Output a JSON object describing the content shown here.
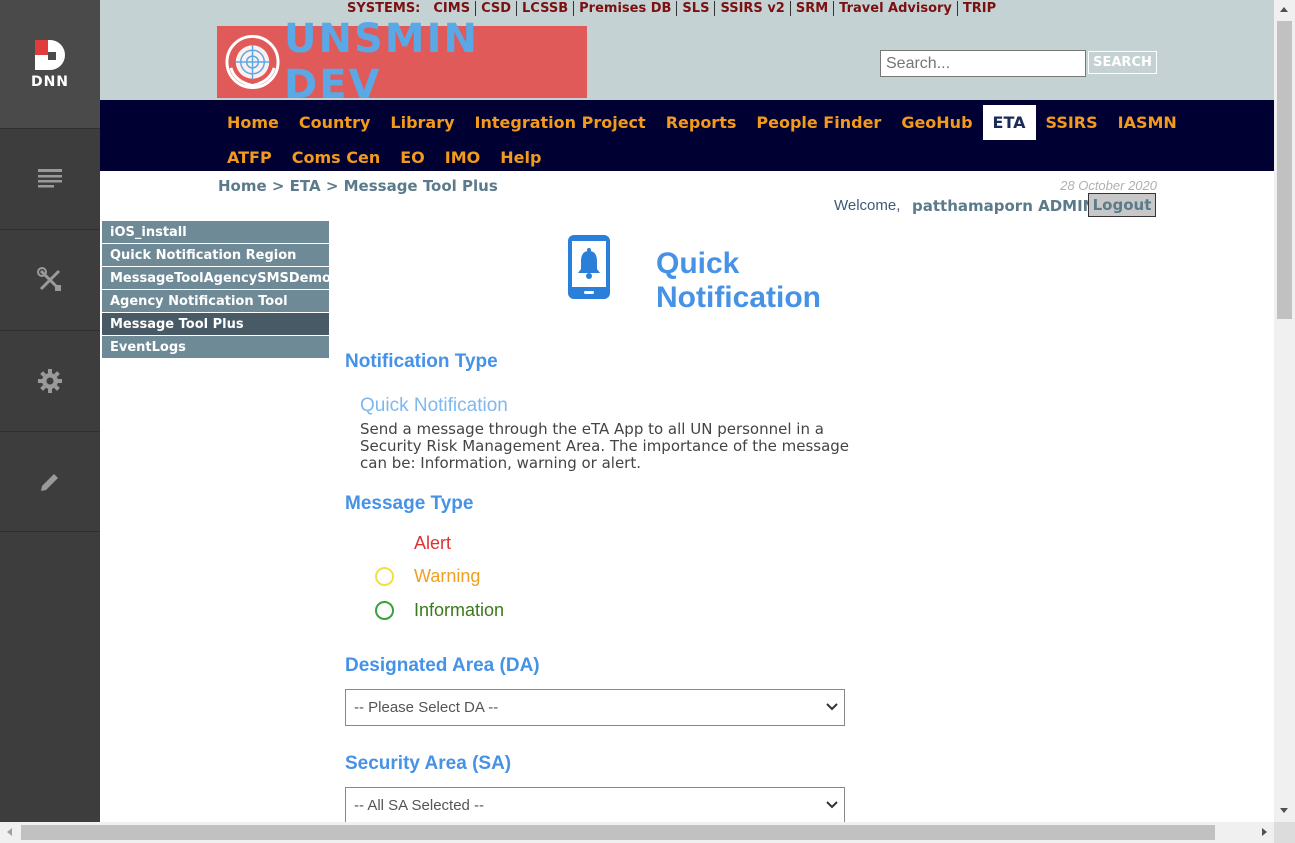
{
  "persona_bar": {
    "logo_text": "DNN",
    "items": [
      "content-icon",
      "tools-icon",
      "settings-icon",
      "edit-icon"
    ]
  },
  "systems": {
    "label": "SYSTEMS:",
    "items": [
      "CIMS",
      "CSD",
      "LCSSB",
      "Premises DB",
      "SLS",
      "SSIRS v2",
      "SRM",
      "Travel Advisory",
      "TRIP"
    ]
  },
  "banner": {
    "text": "UNSMIN DEV"
  },
  "search": {
    "placeholder": "Search...",
    "button_label": "SEARCH"
  },
  "main_nav": {
    "row1": [
      "Home",
      "Country",
      "Library",
      "Integration Project",
      "Reports",
      "People Finder",
      "GeoHub",
      "ETA",
      "SSIRS",
      "IASMN"
    ],
    "row2": [
      "ATFP",
      "Coms Cen",
      "EO",
      "IMO",
      "Help"
    ],
    "active": "ETA"
  },
  "breadcrumb": "Home > ETA > Message Tool Plus",
  "date": "28 October 2020",
  "user": {
    "welcome": "Welcome,",
    "name": "patthamaporn ADMIN",
    "logout_label": "Logout"
  },
  "side_nav": {
    "items": [
      "iOS_install",
      "Quick Notification Region",
      "MessageToolAgencySMSDemo",
      "Agency Notification Tool",
      "Message Tool Plus",
      "EventLogs"
    ],
    "active": "Message Tool Plus"
  },
  "content": {
    "title": "Quick Notification",
    "notification_type_heading": "Notification Type",
    "notification_type_name": "Quick Notification",
    "notification_type_desc": "Send a message through the eTA App to all UN personnel in a Security Risk Management Area. The importance of the message can be: Information, warning or alert.",
    "message_type_heading": "Message Type",
    "message_types": [
      {
        "label": "Alert",
        "color": "#e03030"
      },
      {
        "label": "Warning",
        "color": "#f0a020"
      },
      {
        "label": "Information",
        "color": "#3a7a1a"
      }
    ],
    "da_heading": "Designated Area (DA)",
    "da_selected": "-- Please Select DA --",
    "sa_heading": "Security Area (SA)",
    "sa_selected": "-- All SA Selected --"
  },
  "colors": {
    "accent_blue": "#4592e6",
    "nav_orange": "#f39a1c",
    "nav_bg": "#000033",
    "topbar_bg": "#c5d2d4"
  }
}
